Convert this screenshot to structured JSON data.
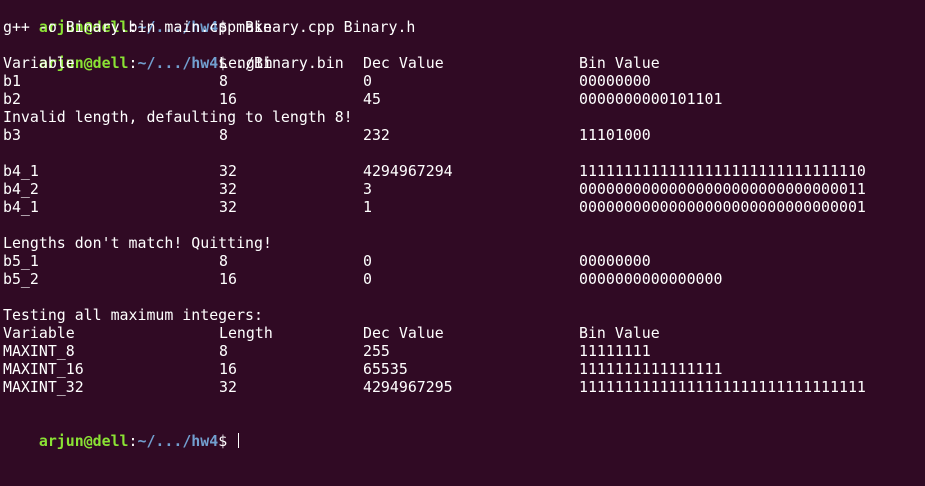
{
  "colors": {
    "background": "#300a24",
    "foreground": "#ffffff",
    "prompt_user": "#8ae234",
    "prompt_path": "#729fcf"
  },
  "prompt": {
    "user_host": "arjun@dell",
    "sep": ":",
    "path": "~/.../hw4",
    "symbol": "$ "
  },
  "commands": {
    "make": "make",
    "compile_output": "g++ -o Binary.bin main.cpp Binary.cpp Binary.h",
    "run": "./Binary.bin"
  },
  "headers": [
    "Variable",
    "Length",
    "Dec Value",
    "Bin Value"
  ],
  "block1": [
    [
      "b1",
      "8",
      "0",
      "00000000"
    ],
    [
      "b2",
      "16",
      "45",
      "0000000000101101"
    ]
  ],
  "msg_invalid": "Invalid length, defaulting to length 8!",
  "row_b3": [
    "b3",
    "8",
    "232",
    "11101000"
  ],
  "block2": [
    [
      "b4_1",
      "32",
      "4294967294",
      "11111111111111111111111111111110"
    ],
    [
      "b4_2",
      "32",
      "3",
      "00000000000000000000000000000011"
    ],
    [
      "b4_1",
      "32",
      "1",
      "00000000000000000000000000000001"
    ]
  ],
  "msg_mismatch": "Lengths don't match! Quitting!",
  "block3": [
    [
      "b5_1",
      "8",
      "0",
      "00000000"
    ],
    [
      "b5_2",
      "16",
      "0",
      "0000000000000000"
    ]
  ],
  "msg_maxint": "Testing all maximum integers:",
  "block4": [
    [
      "MAXINT_8",
      "8",
      "255",
      "11111111"
    ],
    [
      "MAXINT_16",
      "16",
      "65535",
      "1111111111111111"
    ],
    [
      "MAXINT_32",
      "32",
      "4294967295",
      "11111111111111111111111111111111"
    ]
  ]
}
